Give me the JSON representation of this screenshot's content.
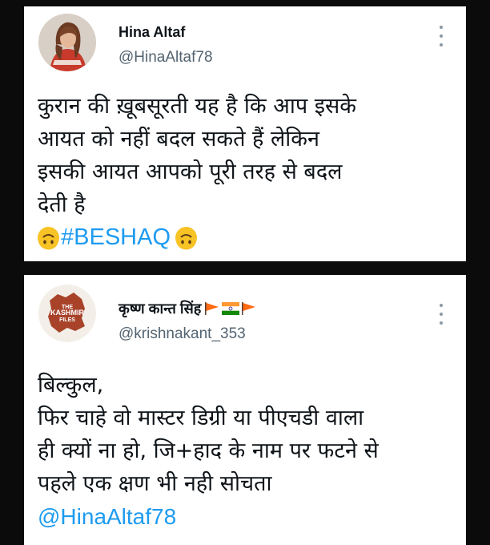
{
  "tweets": [
    {
      "author_name": "Hina Altaf",
      "handle": "@HinaAltaf78",
      "avatar": "user-photo-avatar",
      "more_icon": "more-options-icon",
      "lines": [
        "कुरान की ख़ूबसूरती यह है कि आप इसके",
        "आयत  को नहीं बदल सकते हैं लेकिन",
        "इसकी आयत  आपको पूरी तरह से बदल",
        "देती है"
      ],
      "hashtag": "#BESHAQ",
      "emoji": "upside-down-face-emoji"
    },
    {
      "author_name": "कृष्ण कान्त सिंह",
      "name_emojis": [
        "saffron-flag",
        "india-flag",
        "saffron-flag"
      ],
      "handle": "@krishnakant_353",
      "avatar": "the-kashmir-files-avatar",
      "avatar_text": [
        "THE",
        "KASHMIR",
        "FILES"
      ],
      "more_icon": "more-options-icon",
      "lines": [
        "बिल्कुल,",
        "फिर चाहे वो मास्टर डिग्री या पीएचडी वाला",
        "ही क्यों ना हो, जि+हाद के नाम पर फटने से",
        "पहले एक क्षण भी नही सोचता"
      ],
      "mention": "@HinaAltaf78"
    }
  ],
  "colors": {
    "background": "#0b0b0b",
    "card": "#ffffff",
    "text": "#0f1419",
    "secondary": "#536471",
    "link": "#1d9bf0",
    "saffron": "#ff6a13"
  }
}
